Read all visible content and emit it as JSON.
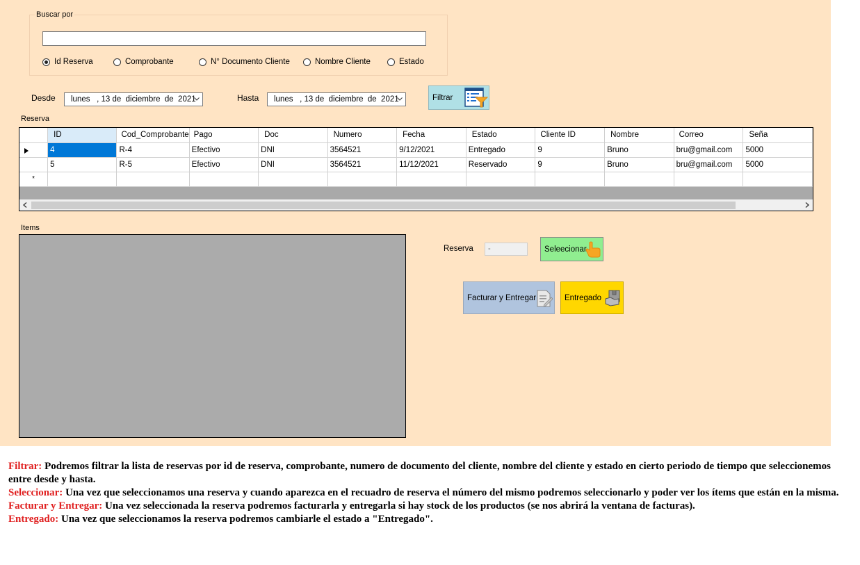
{
  "search": {
    "group_title": "Buscar por",
    "value": "",
    "radios": [
      {
        "label": "Id Reserva",
        "checked": true
      },
      {
        "label": "Comprobante",
        "checked": false
      },
      {
        "label": "N° Documento Cliente",
        "checked": false
      },
      {
        "label": "Nombre Cliente",
        "checked": false
      },
      {
        "label": "Estado",
        "checked": false
      }
    ]
  },
  "dates": {
    "desde_label": "Desde",
    "desde_value": "lunes   , 13 de  diciembre  de  2021",
    "hasta_label": "Hasta",
    "hasta_value": "lunes   , 13 de  diciembre  de  2021"
  },
  "filter_button": {
    "label": "Filtrar",
    "icon": "filter-list-icon",
    "color": "#b0e0e6"
  },
  "reserva_grid": {
    "label": "Reserva",
    "columns": [
      "ID",
      "Cod_Comprobante",
      "Pago",
      "Doc",
      "Numero",
      "Fecha",
      "Estado",
      "Cliente ID",
      "Nombre",
      "Correo",
      "Seña"
    ],
    "rows": [
      [
        "4",
        "R-4",
        "Efectivo",
        "DNI",
        "3564521",
        "9/12/2021",
        "Entregado",
        "9",
        "Bruno",
        "bru@gmail.com",
        "5000"
      ],
      [
        "5",
        "R-5",
        "Efectivo",
        "DNI",
        "3564521",
        "11/12/2021",
        "Reservado",
        "9",
        "Bruno",
        "bru@gmail.com",
        "5000"
      ]
    ],
    "new_row_marker": "*",
    "selected_color": "#0078d7"
  },
  "items": {
    "label": "Items"
  },
  "selection": {
    "reserva_label": "Reserva",
    "reserva_value": "-",
    "select_button": {
      "label": "Seleecionar",
      "color": "#90ee90",
      "icon": "hand-pointer-icon"
    },
    "invoice_button": {
      "label": "Facturar y Entregar",
      "color": "#b0c4de",
      "icon": "invoice-icon"
    },
    "delivered_button": {
      "label": "Entregado",
      "color": "#ffd700",
      "icon": "delivery-box-icon"
    }
  },
  "description": [
    {
      "key": "Filtrar:",
      "text": " Podremos filtrar la lista de reservas por id de reserva, comprobante, numero de documento del cliente, nombre del cliente y estado en cierto periodo de tiempo que seleccionemos entre desde y hasta."
    },
    {
      "key": "Seleccionar:",
      "text": " Una vez que seleccionamos una reserva y cuando aparezca en el recuadro de reserva el número del mismo podremos seleccionarlo y poder ver los ítems que están en la misma."
    },
    {
      "key": "Facturar y Entregar:",
      "text": " Una vez seleccionada la reserva podremos facturarla y entregarla si hay stock de los productos (se nos abrirá la ventana de facturas)."
    },
    {
      "key": "Entregado:",
      "text": " Una vez que seleccionamos la reserva podremos cambiarle el estado a \"Entregado\"."
    }
  ]
}
